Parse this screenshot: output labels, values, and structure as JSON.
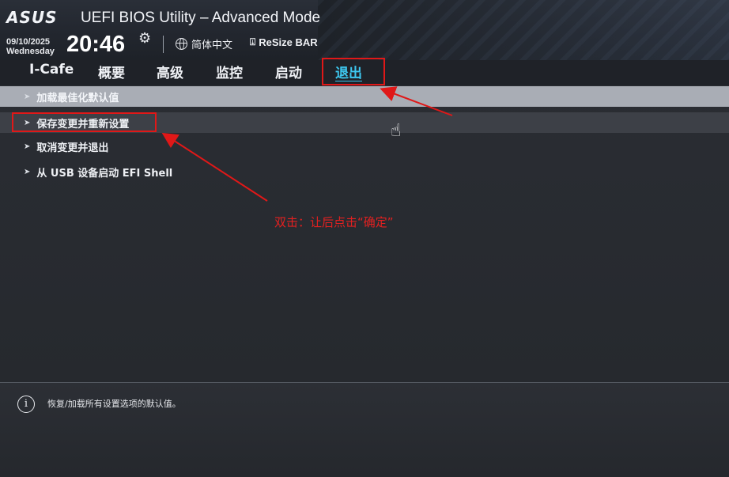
{
  "header": {
    "logo": "ASUS",
    "title": "UEFI BIOS Utility – Advanced Mode",
    "date": "09/10/2025",
    "weekday": "Wednesday",
    "time": "20:46",
    "settings_icon": "gear-icon",
    "language": "简体中文",
    "language_icon": "globe-icon",
    "resize_bar": "ReSize BAR",
    "resize_icon": "resize-bar-icon"
  },
  "tabs": [
    {
      "label": "I-Cafe"
    },
    {
      "label": "概要"
    },
    {
      "label": "高级"
    },
    {
      "label": "监控"
    },
    {
      "label": "启动"
    },
    {
      "label": "退出",
      "active": true
    }
  ],
  "menu": {
    "items": [
      {
        "label": "加载最佳化默认值"
      },
      {
        "label": "保存变更并重新设置"
      },
      {
        "label": "取消变更并退出"
      },
      {
        "label": "从 USB 设备启动 EFI Shell"
      }
    ]
  },
  "annotation": {
    "text": "双击：让后点击“确定”",
    "color": "#e42020"
  },
  "help": {
    "icon": "info-icon",
    "text": "恢复/加载所有设置选项的默认值。"
  },
  "colors": {
    "accent": "#3ec8f0",
    "annotation_red": "#e01818",
    "selected_row": "#a9adb5"
  }
}
